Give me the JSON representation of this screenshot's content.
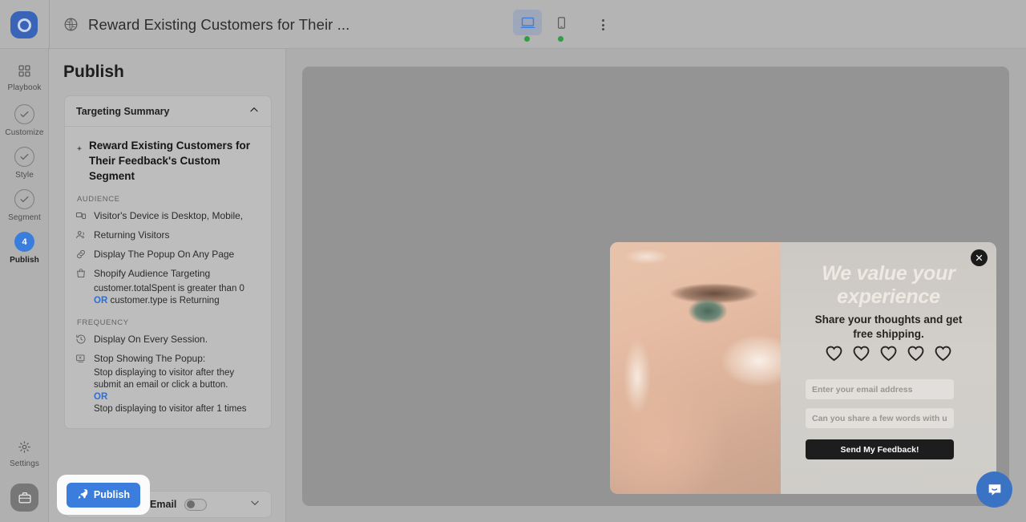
{
  "topbar": {
    "logo_icon": "popupsmart-logo-icon",
    "globe_icon": "globe-icon",
    "title": "Reward Existing Customers for Their ...",
    "devices": [
      {
        "name": "desktop",
        "icon": "desktop-icon",
        "active": true,
        "status": "online"
      },
      {
        "name": "mobile",
        "icon": "mobile-icon",
        "active": false,
        "status": "online"
      }
    ],
    "more_icon": "kebab-menu-icon"
  },
  "rail": {
    "items": [
      {
        "label": "Playbook",
        "icon": "grid-icon",
        "state": "plain"
      },
      {
        "label": "Customize",
        "icon": "check-circle-icon",
        "state": "done"
      },
      {
        "label": "Style",
        "icon": "check-circle-icon",
        "state": "done"
      },
      {
        "label": "Segment",
        "icon": "check-circle-icon",
        "state": "done"
      },
      {
        "label": "Publish",
        "icon": "step-number",
        "badge": "4",
        "state": "active"
      }
    ],
    "settings": {
      "label": "Settings",
      "icon": "gear-icon"
    },
    "workspace_icon": "briefcase-icon"
  },
  "panel": {
    "title": "Publish",
    "targeting": {
      "header": "Targeting Summary",
      "collapse_icon": "chevron-up-icon",
      "segment_icon": "sparkle-icon",
      "segment_name": "Reward Existing Customers for Their Feedback's Custom Segment",
      "audience_label": "AUDIENCE",
      "audience_rows": [
        {
          "icon": "device-icon",
          "text": "Visitor's Device is Desktop, Mobile,"
        },
        {
          "icon": "users-icon",
          "text": "Returning Visitors"
        },
        {
          "icon": "link-icon",
          "text": "Display The Popup On Any Page"
        },
        {
          "icon": "shopify-bag-icon",
          "text": "Shopify Audience Targeting"
        }
      ],
      "shopify_rule_1": "customer.totalSpent is greater than 0",
      "shopify_rule_or": "OR",
      "shopify_rule_2": "customer.type is Returning",
      "frequency_label": "FREQUENCY",
      "frequency_rows": [
        {
          "icon": "clock-history-icon",
          "text": "Display On Every Session."
        },
        {
          "icon": "stop-popup-icon",
          "text": "Stop Showing The Popup:"
        }
      ],
      "stop_rule_1": "Stop displaying to visitor after they submit an email or click a button.",
      "stop_rule_or": "OR",
      "stop_rule_2": "Stop displaying to visitor after 1 times"
    },
    "autoresponder": {
      "label": "Autoresponder Email",
      "toggle_on": false,
      "expand_icon": "chevron-down-icon"
    },
    "publish_button": {
      "label": "Publish",
      "icon": "rocket-icon",
      "color": "#3b7ddd"
    }
  },
  "popup_preview": {
    "close_icon": "close-icon",
    "heading": "We value your experience",
    "subheading": "Share your thoughts and get free shipping.",
    "rating": {
      "icon": "heart-outline-icon",
      "count": 5,
      "selected": 0
    },
    "email_placeholder": "Enter your email address",
    "message_placeholder": "Can you share a few words with u",
    "submit_label": "Send My Feedback!",
    "image_alt": "close-up-face-with-skincare-cream"
  },
  "chat_widget": {
    "icon": "chat-bubble-icon",
    "color": "#3b73c4"
  }
}
